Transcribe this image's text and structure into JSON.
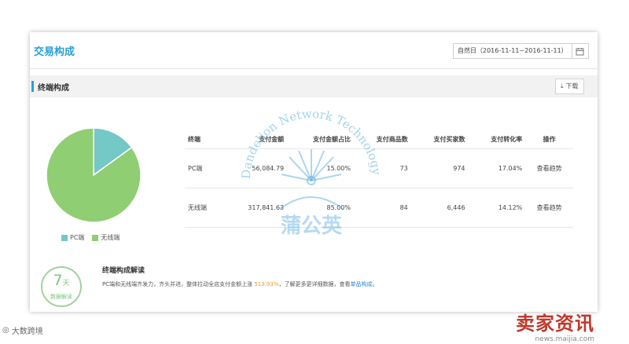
{
  "header": {
    "title": "交易构成"
  },
  "date_picker": {
    "range": "自然日（2016-11-11~2016-11-11）"
  },
  "section": {
    "title": "终端构成",
    "download_label": "下载"
  },
  "pie_chart": {
    "slices": [
      {
        "name": "PC端",
        "value": 15.0,
        "color": "#74c8c6"
      },
      {
        "name": "无线端",
        "value": 85.0,
        "color": "#8fce72"
      }
    ]
  },
  "table": {
    "headers": [
      "终端",
      "支付金额",
      "支付金额占比",
      "支付商品数",
      "支付买家数",
      "支付转化率",
      "操作"
    ],
    "rows": [
      {
        "terminal": "PC端",
        "amount": "56,084.79",
        "share": "15.00%",
        "items": "73",
        "buyers": "974",
        "conversion": "17.04%",
        "action": "查看趋势"
      },
      {
        "terminal": "无线端",
        "amount": "317,841.63",
        "share": "85.00%",
        "items": "84",
        "buyers": "6,446",
        "conversion": "14.12%",
        "action": "查看趋势"
      }
    ]
  },
  "analysis": {
    "badge_number": "7",
    "badge_unit": "天",
    "badge_label": "数据解读",
    "title": "终端构成解读",
    "text_before": "PC端和无线端齐发力，齐头并进，整体拉动全店支付金额上涨",
    "highlight": "513.93%",
    "text_after": "，了解更多更详细数据，查看",
    "link": "单品构成",
    "suffix": "。"
  },
  "watermark": {
    "arc_text": "Dandelion Network Technology",
    "chars": "蒲公英"
  },
  "logos": {
    "left": "大数跨境",
    "right_big": "卖家资讯",
    "right_small": "news.maijia.com"
  }
}
